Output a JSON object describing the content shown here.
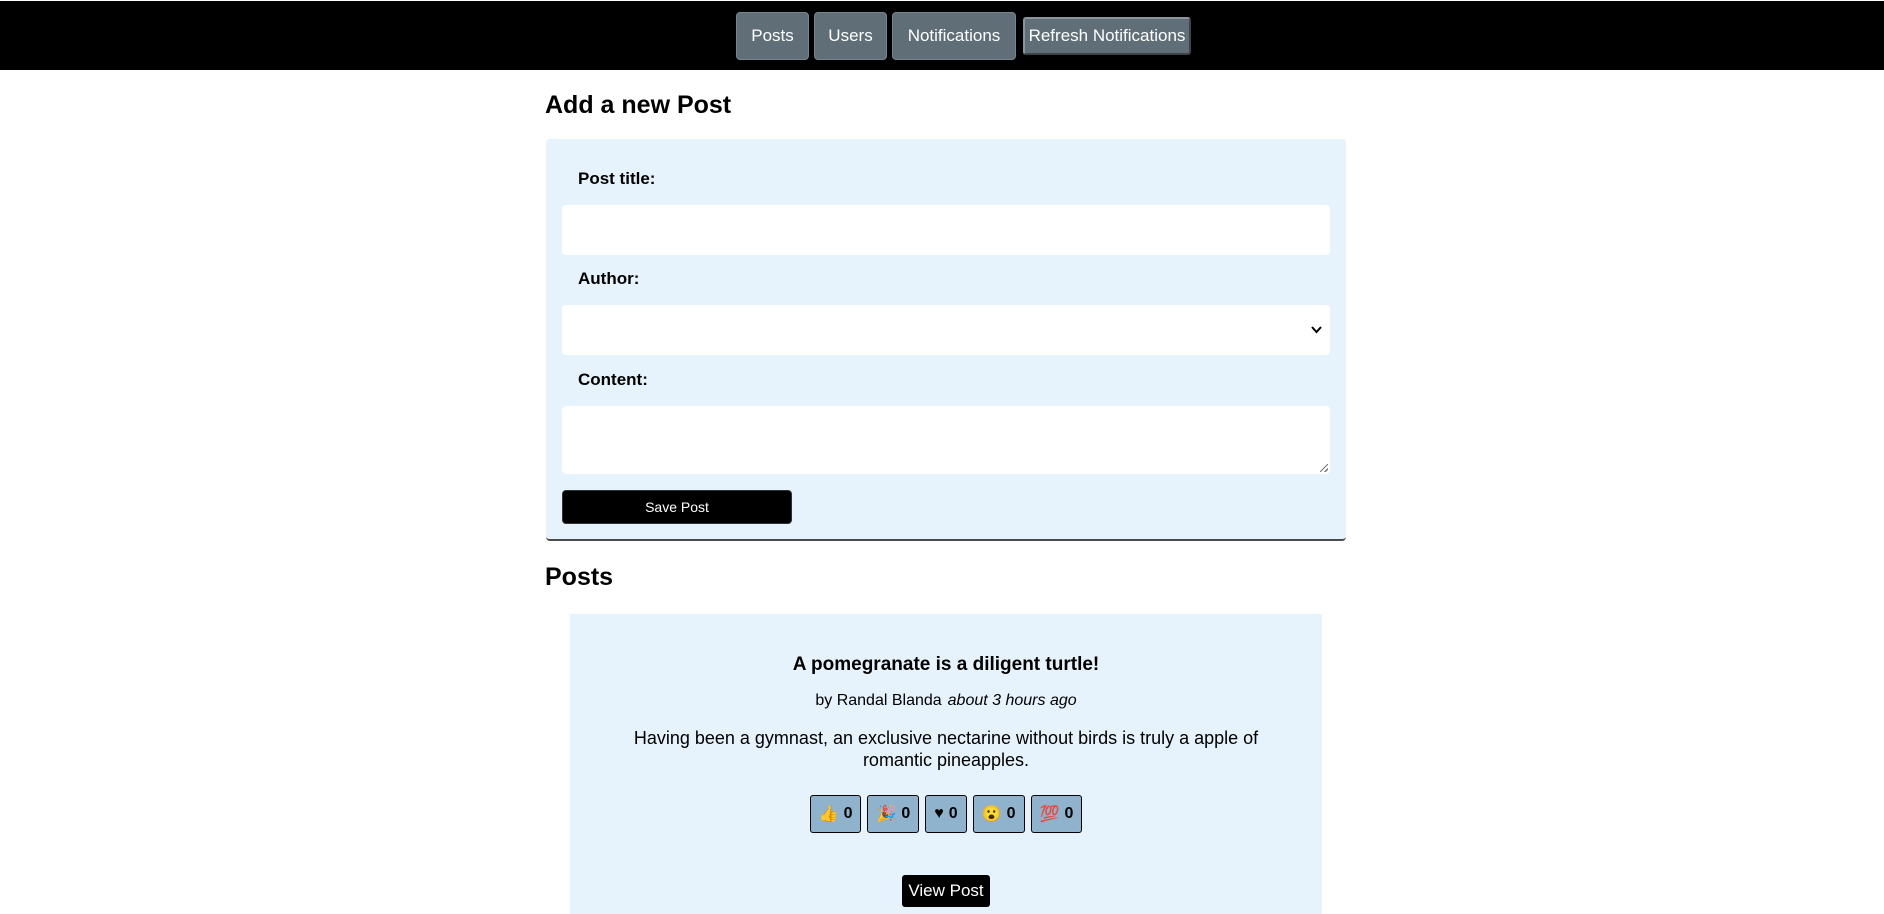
{
  "nav": {
    "posts": "Posts",
    "users": "Users",
    "notifications": "Notifications",
    "refresh": "Refresh Notifications"
  },
  "add_form": {
    "heading": "Add a new Post",
    "title_label": "Post title:",
    "title_value": "",
    "author_label": "Author:",
    "author_value": "",
    "content_label": "Content:",
    "content_value": "",
    "save_label": "Save Post"
  },
  "posts_section": {
    "heading": "Posts",
    "posts": [
      {
        "title": "A pomegranate is a diligent turtle!",
        "author": "by Randal Blanda",
        "time": "about 3 hours ago",
        "content": "Having been a gymnast, an exclusive nectarine without birds is truly a apple of romantic pineapples.",
        "reactions": [
          {
            "icon": "👍",
            "icon_name": "thumbs-up-icon",
            "count": "0"
          },
          {
            "icon": "🎉",
            "icon_name": "party-popper-icon",
            "count": "0"
          },
          {
            "icon": "♥",
            "icon_name": "heart-icon",
            "count": "0"
          },
          {
            "icon": "😮",
            "icon_name": "surprised-face-icon",
            "count": "0"
          },
          {
            "icon": "💯",
            "icon_name": "hundred-points-icon",
            "count": "0"
          }
        ],
        "view_label": "View Post"
      }
    ]
  },
  "colors": {
    "navbar": "#000000",
    "nav_button": "#5f6e77",
    "panel": "#e6f3fc",
    "reaction_button": "#8fb3cc"
  }
}
